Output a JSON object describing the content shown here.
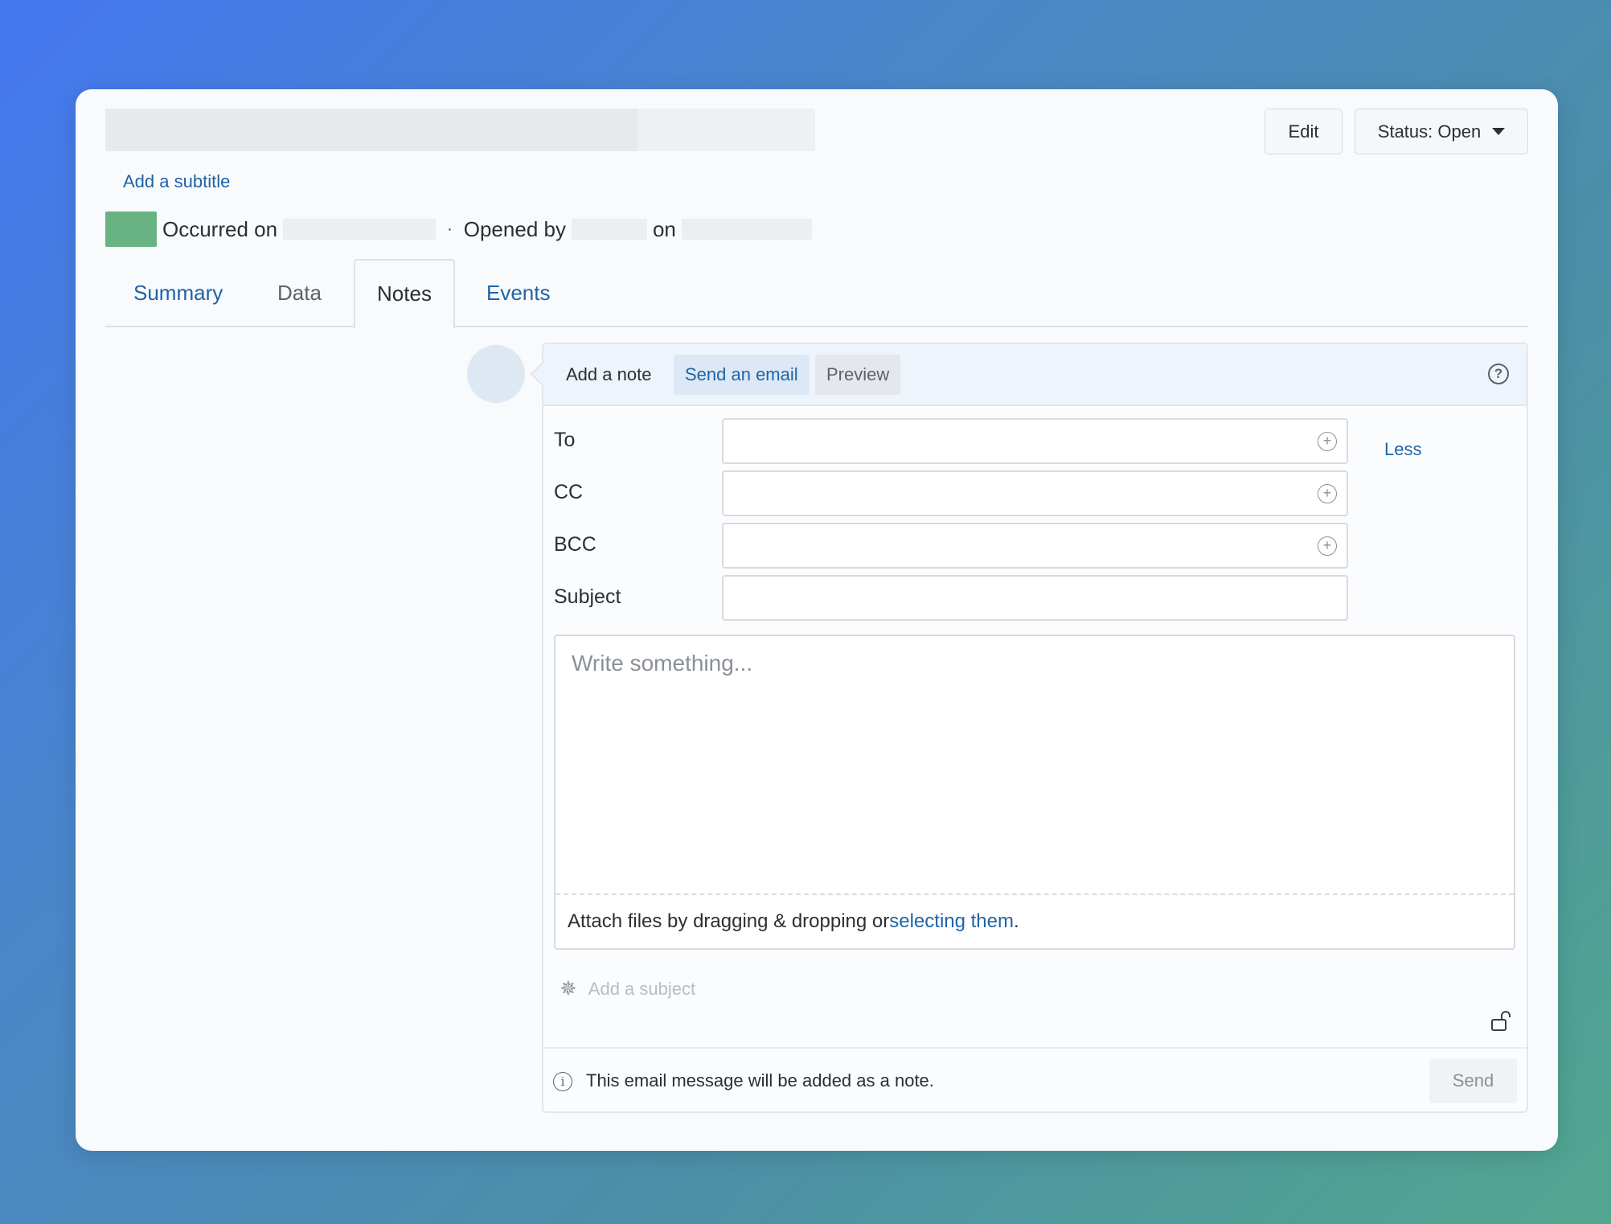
{
  "header": {
    "edit_label": "Edit",
    "status_label": "Status: Open",
    "subtitle_link": "Add a subtitle",
    "meta": {
      "occurred_on": "Occurred on",
      "separator": "·",
      "opened_by": "Opened by",
      "on": "on"
    }
  },
  "tabs": [
    {
      "label": "Summary",
      "active": false
    },
    {
      "label": "Data",
      "active": false
    },
    {
      "label": "Notes",
      "active": true
    },
    {
      "label": "Events",
      "active": false
    }
  ],
  "composer": {
    "tabs": {
      "add_note": "Add a note",
      "send_email": "Send an email",
      "preview": "Preview"
    },
    "help_icon": "?",
    "fields": {
      "to_label": "To",
      "cc_label": "CC",
      "bcc_label": "BCC",
      "subject_label": "Subject",
      "to_value": "",
      "cc_value": "",
      "bcc_value": "",
      "subject_value": ""
    },
    "less_link": "Less",
    "editor_placeholder": "Write something...",
    "attach": {
      "prefix": "Attach files by dragging & dropping or ",
      "link": "selecting them",
      "suffix": "."
    },
    "subject_placeholder": "Add a subject",
    "footer_text": "This email message will be added as a note.",
    "send_label": "Send"
  },
  "colors": {
    "accent": "#1f63a8",
    "status_badge": "#68b381",
    "card_bg": "#f8fafc"
  },
  "icons": [
    "caret-down-icon",
    "help-icon",
    "plus-circle-icon",
    "sparkle-icon",
    "unlock-icon",
    "info-icon"
  ]
}
